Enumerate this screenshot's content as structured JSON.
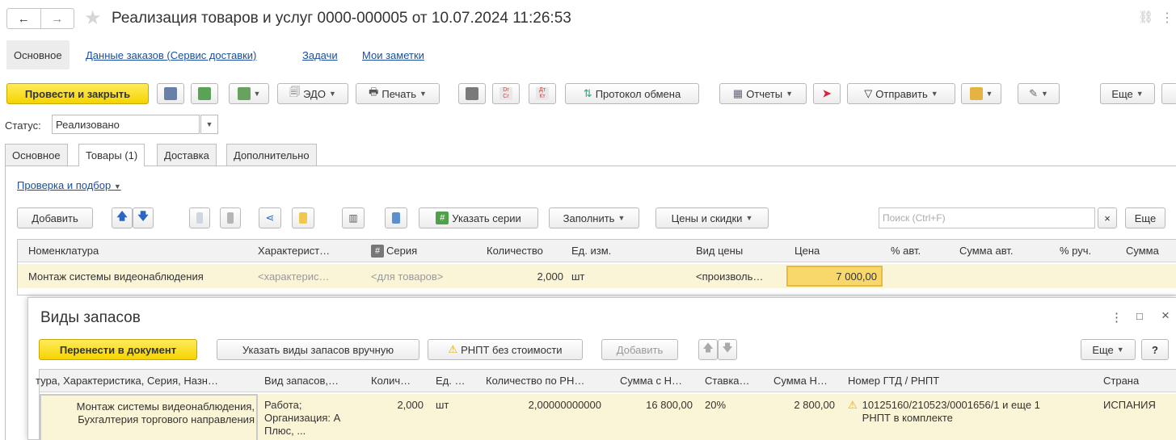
{
  "title": "Реализация товаров и услуг 0000-000005 от 10.07.2024 11:26:53",
  "nav": {
    "back": "←",
    "forward": "→",
    "star": "★",
    "link_icon": "⛓",
    "menu": "⋮"
  },
  "top_tabs": [
    "Основное",
    "Данные заказов (Сервис доставки)",
    "Задачи",
    "Мои заметки"
  ],
  "toolbar": {
    "post_close": "Провести и закрыть",
    "edo": "ЭДО",
    "print": "Печать",
    "protocol": "Протокол обмена",
    "reports": "Отчеты",
    "send": "Отправить",
    "more": "Еще",
    "dr": "Dr",
    "cr": "Cr",
    "dt": "Дт",
    "kt": "Кт"
  },
  "status": {
    "label": "Статус:",
    "value": "Реализовано"
  },
  "doc_tabs": [
    "Основное",
    "Товары (1)",
    "Доставка",
    "Дополнительно"
  ],
  "check_link": "Проверка и подбор",
  "goods_toolbar": {
    "add": "Добавить",
    "series": "Указать серии",
    "fill": "Заполнить",
    "prices": "Цены и скидки",
    "search_placeholder": "Поиск (Ctrl+F)",
    "clear": "×",
    "more": "Еще"
  },
  "goods_columns": [
    "Номенклатура",
    "Характерист…",
    "Серия",
    "Количество",
    "Ед. изм.",
    "Вид цены",
    "Цена",
    "% авт.",
    "Сумма авт.",
    "% руч.",
    "Сумма"
  ],
  "goods_row": {
    "name": "Монтаж системы видеонаблюдения",
    "char": "<характерис…",
    "series": "<для товаров>",
    "qty": "2,000",
    "unit": "шт",
    "price_type": "<произволь…",
    "price": "7 000,00"
  },
  "dialog": {
    "title": "Виды запасов",
    "menu": "⋮",
    "maximize": "□",
    "close": "×",
    "transfer": "Перенести в документ",
    "manual": "Указать виды запасов вручную",
    "rnpt": "РНПТ без стоимости",
    "add": "Добавить",
    "more": "Еще",
    "help": "?"
  },
  "stock_columns": [
    "тура, Характеристика, Серия, Назн…",
    "Вид запасов,…",
    "Колич…",
    "Ед. …",
    "Количество по РН…",
    "Сумма с Н…",
    "Ставка…",
    "Сумма Н…",
    "Номер ГТД / РНПТ",
    "Страна"
  ],
  "stock_row": {
    "name1": "Монтаж системы видеонаблюдения,",
    "name2": "Бухгалтерия торгового направления",
    "kind1": "Работа;",
    "kind2": "Организация: А",
    "kind3": "Плюс, ...",
    "qty": "2,000",
    "unit": "шт",
    "qty_rnpt": "2,00000000000",
    "sum_vat": "16 800,00",
    "rate": "20%",
    "vat": "2 800,00",
    "gtd1": "10125160/210523/0001656/1 и еще 1",
    "gtd2": "РНПТ в комплекте",
    "country": "ИСПАНИЯ"
  }
}
